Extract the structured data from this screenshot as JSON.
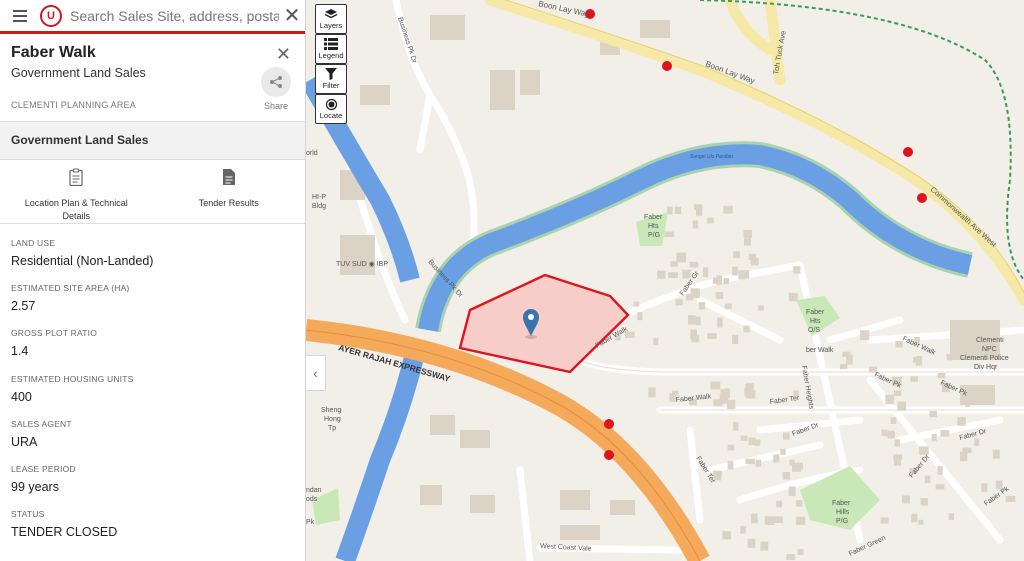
{
  "search": {
    "placeholder": "Search Sales Site, address, postal code"
  },
  "logo_text": "U",
  "site": {
    "title": "Faber Walk",
    "subtitle": "Government Land Sales",
    "planning_area": "CLEMENTI PLANNING AREA",
    "share_label": "Share"
  },
  "section": {
    "title": "Government Land Sales"
  },
  "documents": [
    {
      "label": "Location Plan & Technical Details",
      "icon": "clipboard-icon"
    },
    {
      "label": "Tender Results",
      "icon": "document-icon"
    }
  ],
  "details": [
    {
      "label": "LAND USE",
      "value": "Residential (Non-Landed)"
    },
    {
      "label": "ESTIMATED SITE AREA (HA)",
      "value": "2.57"
    },
    {
      "label": "GROSS PLOT RATIO",
      "value": "1.4"
    },
    {
      "label": "ESTIMATED HOUSING UNITS",
      "value": "400"
    },
    {
      "label": "SALES AGENT",
      "value": "URA"
    },
    {
      "label": "LEASE PERIOD",
      "value": "99 years"
    },
    {
      "label": "STATUS",
      "value": "TENDER CLOSED"
    }
  ],
  "map_controls": [
    {
      "label": "Layers",
      "icon": "layers-icon"
    },
    {
      "label": "Legend",
      "icon": "list-icon"
    },
    {
      "label": "Filter",
      "icon": "filter-icon"
    },
    {
      "label": "Locate",
      "icon": "locate-icon"
    }
  ],
  "map_labels": {
    "boon_lay_way_1": "Boon Lay Way",
    "boon_lay_way_2": "Boon Lay Way",
    "toh_tuck_ave": "Toh Tuck Ave",
    "business_pk_dr_1": "Business Pk Dr",
    "business_pk_dr_2": "Business Pk Dr",
    "commonwealth": "Commonwealth Ave West",
    "ayer_rajah": "AYER RAJAH EXPRESSWAY",
    "hi_p": "HI-P",
    "bldg": "Bldg",
    "orld": "orld",
    "tuv_sud": "TUV SUD ◉ IBP",
    "sungei": "Sungei Ulu Pandan",
    "faber_hts_1": "Faber",
    "faber_hts_2": "Hts",
    "faber_hts_3": "P/G",
    "faber_hts_os_1": "Faber",
    "faber_hts_os_2": "Hts",
    "faber_hts_os_3": "O/S",
    "faber_walk_1": "Faber Walk",
    "faber_walk_2": "ber Walk",
    "faber_walk_3": "Faber Walk",
    "faber_walk_4": "Faber Walk",
    "faber_gr": "Faber Gr",
    "faber_pk_1": "Faber Pk",
    "faber_pk_2": "Faber Pk",
    "faber_pk_3": "Faber Pk",
    "faber_heights": "Faber Heights",
    "faber_ter_1": "Faber Ter",
    "faber_ter_2": "Faber Ter",
    "faber_dr_1": "Faber Dr",
    "faber_dr_2": "Faber Dr",
    "faber_dr_3": "Faber Dr",
    "faber_green": "Faber Green",
    "faber_hills_1": "Faber",
    "faber_hills_2": "Hills",
    "faber_hills_3": "P/G",
    "police_1": "Clementi",
    "police_2": "NPC",
    "police_3": "Clementi Police",
    "police_4": "Div Hqr",
    "sheng_1": "Sheng",
    "sheng_2": "Hong",
    "sheng_3": "Tp",
    "pandan_1": "ndan",
    "pandan_2": "ods",
    "pandan_3": "Pk",
    "west_coast_vale": "West Coast Vale"
  },
  "colors": {
    "accent": "#d2161e",
    "expressway": "#f5a95a",
    "canal": "#6a9fe3",
    "park": "#c9e8b8",
    "site_fill": "#f6cdc8",
    "site_border": "#e0131b"
  }
}
